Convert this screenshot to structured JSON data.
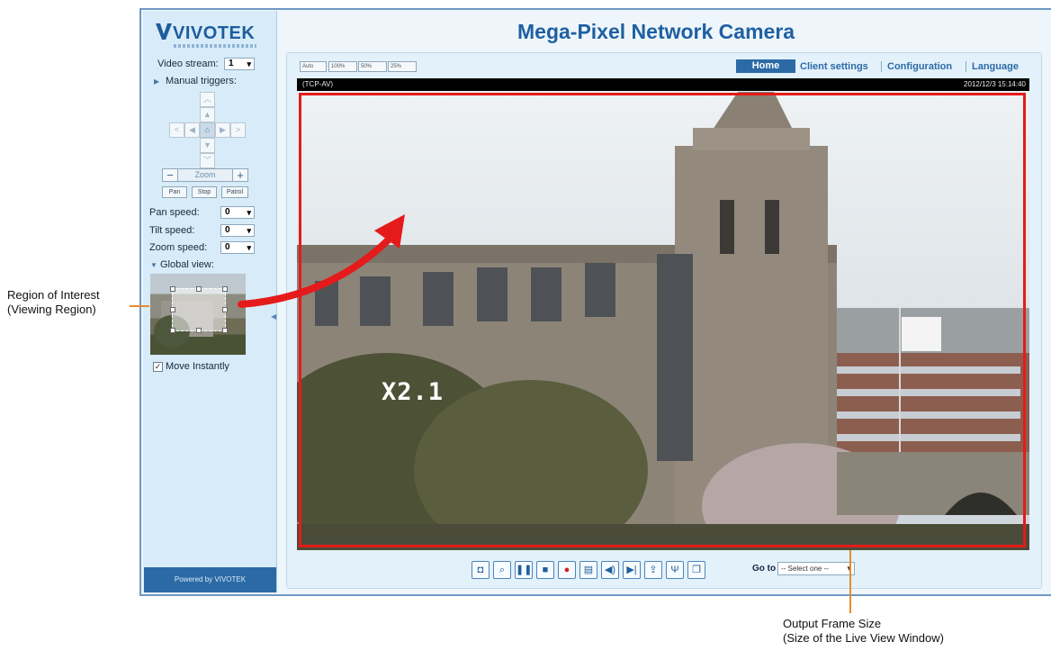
{
  "brand": {
    "logo_text": "VIVOTEK",
    "powered_by": "Powered by VIVOTEK"
  },
  "page_title": "Mega-Pixel Network Camera",
  "sidebar": {
    "video_stream_label": "Video stream:",
    "video_stream_value": "1",
    "manual_triggers_label": "Manual triggers:",
    "zoom_label": "Zoom",
    "pan_button": "Pan",
    "stop_button": "Stop",
    "patrol_button": "Patrol",
    "pan_speed_label": "Pan speed:",
    "pan_speed_value": "0",
    "tilt_speed_label": "Tilt speed:",
    "tilt_speed_value": "0",
    "zoom_speed_label": "Zoom speed:",
    "zoom_speed_value": "0",
    "global_view_label": "Global view:",
    "move_instantly_label": "Move Instantly",
    "move_instantly_checked": true
  },
  "view_size_buttons": [
    "Auto",
    "100%",
    "50%",
    "25%"
  ],
  "nav": {
    "home": "Home",
    "client_settings": "Client settings",
    "configuration": "Configuration",
    "language": "Language"
  },
  "status_bar": {
    "protocol": "(TCP-AV)",
    "timestamp": "2012/12/3 15:14:40"
  },
  "video": {
    "zoom_factor": "X2.1"
  },
  "toolbar": {
    "icons": [
      "camera-icon",
      "digital-zoom-icon",
      "pause-icon",
      "stop-icon",
      "record-icon",
      "volume-icon",
      "mute-icon",
      "talk-icon",
      "upload-icon",
      "microphone-icon",
      "fullscreen-icon"
    ],
    "goto_label": "Go to",
    "goto_value": "-- Select one --"
  },
  "annotations": {
    "roi_line1": "Region of Interest",
    "roi_line2": "(Viewing Region)",
    "output_line1": "Output Frame Size",
    "output_line2": "(Size of the Live View Window)"
  },
  "colors": {
    "brand_blue": "#2c6aa6",
    "roi_frame": "#e51b1b",
    "leader_line": "#e88a2e"
  }
}
